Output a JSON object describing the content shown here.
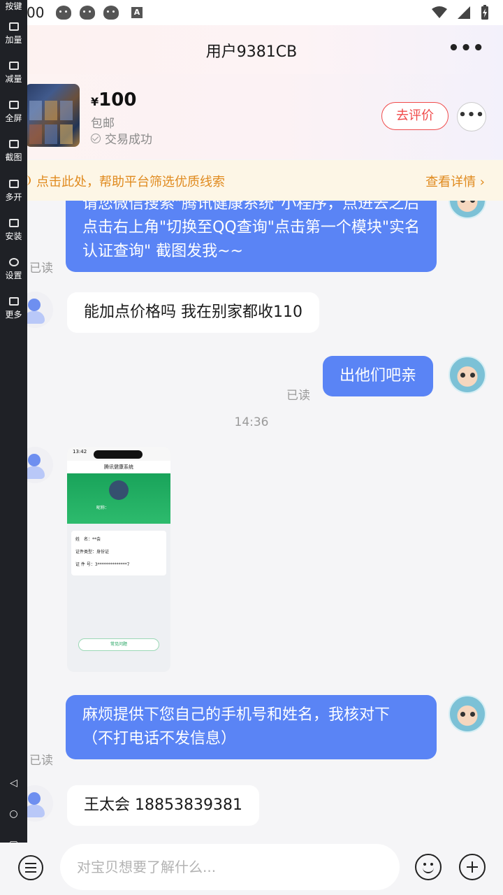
{
  "status_bar": {
    "time": "00"
  },
  "header": {
    "title": "用户9381CB",
    "more": "•••"
  },
  "product": {
    "price_symbol": "¥",
    "price": "100",
    "shipping": "包邮",
    "status": "交易成功",
    "review_label": "去评价",
    "more": "•••"
  },
  "notice": {
    "text": "点击此处，帮助平台筛选优质线索",
    "link": "查看详情 ›"
  },
  "toolbar": {
    "items": [
      {
        "label": "按键"
      },
      {
        "label": "加量"
      },
      {
        "label": "减量"
      },
      {
        "label": "全屏"
      },
      {
        "label": "截图"
      },
      {
        "label": "多开"
      },
      {
        "label": "安装"
      },
      {
        "label": "设置"
      },
      {
        "label": "更多"
      }
    ],
    "nav": {
      "back": "◁",
      "home": "○",
      "recent": "▢"
    }
  },
  "chat": {
    "messages": [
      {
        "text": "请您微信搜索\"腾讯健康系统\"小程序，点进去之后点击右上角\"切换至QQ查询\"点击第一个模块\"实名认证查询\" 截图发我~~",
        "read": "已读"
      },
      {
        "text": "能加点价格吗 我在别家都收110"
      },
      {
        "text": "出他们吧亲",
        "read": "已读"
      },
      {
        "time": "14:36"
      },
      {
        "image": {
          "phone_time": "13:42",
          "title": "腾讯健康系统",
          "nickname": "昵称：",
          "name_row": "姓　名：**会",
          "id_type_row": "证件类型：身份证",
          "id_no_row": "证 件 号：3**************7",
          "faq": "常见问题"
        }
      },
      {
        "text": "麻烦提供下您自己的手机号和姓名，我核对下（不打电话不发信息）",
        "read": "已读"
      },
      {
        "text": "王太会 18853839381"
      }
    ]
  },
  "input": {
    "placeholder": "对宝贝想要了解什么..."
  }
}
